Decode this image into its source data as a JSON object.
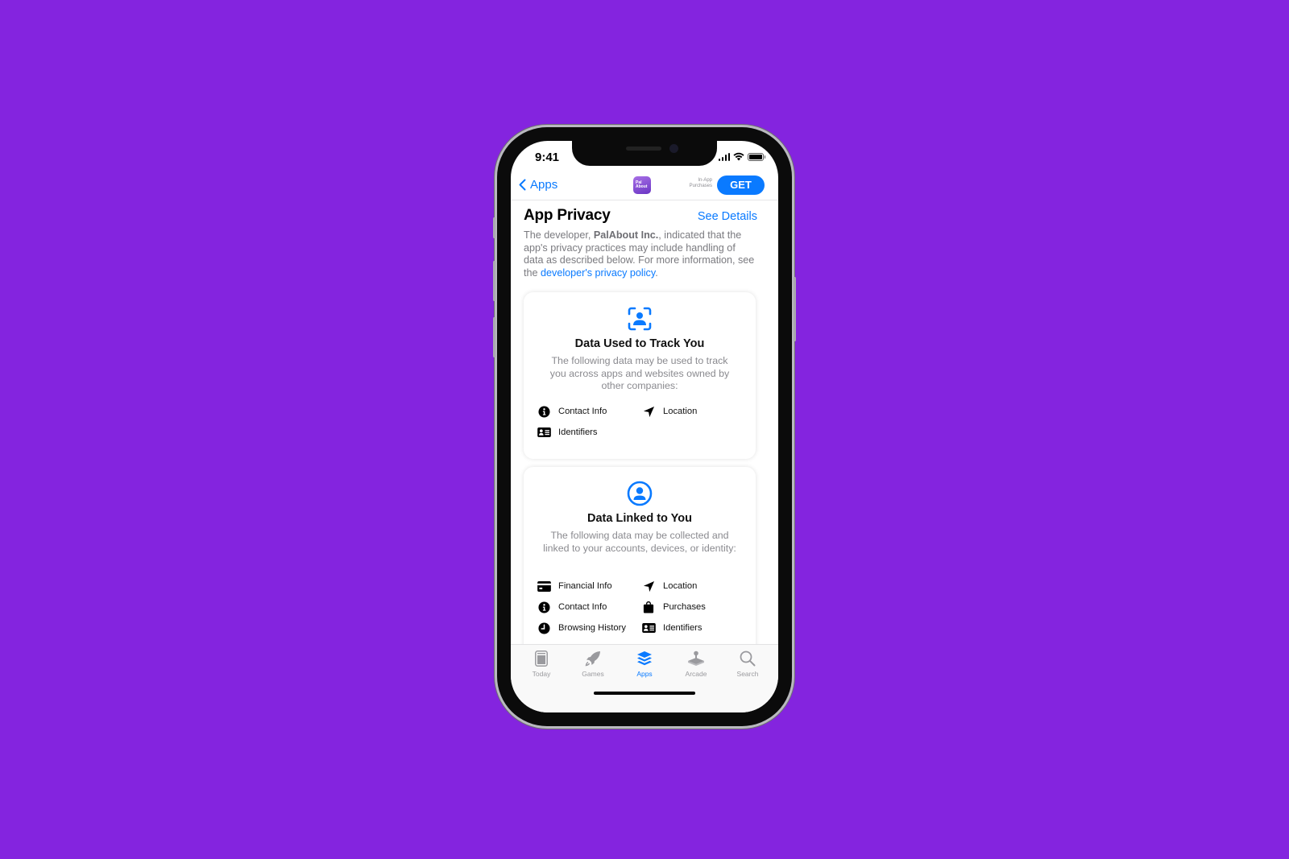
{
  "background_color": "#8424df",
  "accent_color": "#0a7aff",
  "status_bar": {
    "time": "9:41"
  },
  "nav": {
    "back_label": "Apps",
    "app_icon_text_line1": "Pal",
    "app_icon_text_line2": "About",
    "iap_line1": "In-App",
    "iap_line2": "Purchases",
    "get_label": "GET"
  },
  "privacy": {
    "title": "App Privacy",
    "see_details": "See Details",
    "intro_prefix": "The developer, ",
    "developer": "PalAbout Inc.",
    "intro_middle": ", indicated that the app's privacy practices may include handling of data as described below. For more information, see the ",
    "policy_link": "developer's privacy policy",
    "intro_suffix": "."
  },
  "cards": [
    {
      "icon": "person-tracking-icon",
      "title": "Data Used to Track You",
      "description": "The following data may be used to track you across apps and websites owned by other companies:",
      "items": [
        {
          "icon": "info-circle-icon",
          "label": "Contact Info"
        },
        {
          "icon": "location-arrow-icon",
          "label": "Location"
        },
        {
          "icon": "id-card-icon",
          "label": "Identifiers"
        }
      ]
    },
    {
      "icon": "person-circle-icon",
      "title": "Data Linked to You",
      "description": "The following data may be collected and linked to your accounts, devices, or identity:",
      "items": [
        {
          "icon": "credit-card-icon",
          "label": "Financial Info"
        },
        {
          "icon": "location-arrow-icon",
          "label": "Location"
        },
        {
          "icon": "info-circle-icon",
          "label": "Contact Info"
        },
        {
          "icon": "shopping-bag-icon",
          "label": "Purchases"
        },
        {
          "icon": "clock-icon",
          "label": "Browsing History"
        },
        {
          "icon": "id-card-icon",
          "label": "Identifiers"
        }
      ]
    }
  ],
  "tab_bar": {
    "tabs": [
      {
        "icon": "today-icon",
        "label": "Today",
        "active": false
      },
      {
        "icon": "rocket-icon",
        "label": "Games",
        "active": false
      },
      {
        "icon": "layers-icon",
        "label": "Apps",
        "active": true
      },
      {
        "icon": "joystick-icon",
        "label": "Arcade",
        "active": false
      },
      {
        "icon": "search-icon",
        "label": "Search",
        "active": false
      }
    ]
  }
}
